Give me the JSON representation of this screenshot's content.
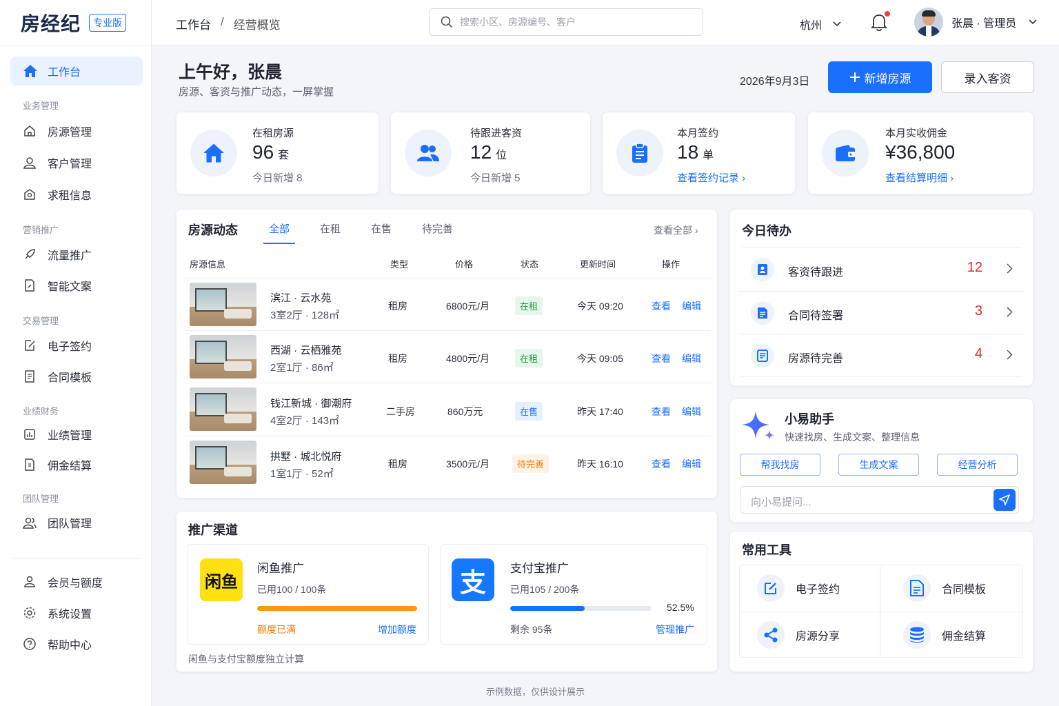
{
  "brand": {
    "name": "房经纪",
    "badge": "专业版"
  },
  "nav": {
    "active": "工作台",
    "groups": {
      "business": "业务管理",
      "marketing": "营销推广",
      "trade": "交易管理",
      "finance": "业绩财务",
      "team": "团队管理"
    },
    "items": {
      "property": "房源管理",
      "customer": "客户管理",
      "rent_info": "求租信息",
      "traffic": "流量推广",
      "copywriting": "智能文案",
      "esign": "电子签约",
      "contract_tpl": "合同模板",
      "performance": "业绩管理",
      "commission": "佣金结算",
      "team": "团队管理",
      "membership": "会员与额度",
      "settings": "系统设置",
      "help": "帮助中心"
    }
  },
  "topbar": {
    "breadcrumb": [
      "工作台",
      "/",
      "经营概览"
    ],
    "search_placeholder": "搜索小区、房源编号、客户",
    "city": "杭州",
    "user": "张晨 · 管理员"
  },
  "header": {
    "greeting": "上午好，张晨",
    "subtitle": "房源、客资与推广动态，一屏掌握",
    "date": "2026年9月3日",
    "btn_add": "新增房源",
    "btn_lead": "录入客资"
  },
  "stats": [
    {
      "label": "在租房源",
      "value": "96",
      "unit": "套",
      "sub": "今日新增 8"
    },
    {
      "label": "待跟进客资",
      "value": "12",
      "unit": "位",
      "sub": "今日新增 5"
    },
    {
      "label": "本月签约",
      "value": "18",
      "unit": "单",
      "sub": "查看签约记录"
    },
    {
      "label": "本月实收佣金",
      "value": "¥36,800",
      "unit": "",
      "sub": "查看结算明细"
    }
  ],
  "listings": {
    "title": "房源动态",
    "tabs": [
      "全部",
      "在租",
      "在售",
      "待完善"
    ],
    "view_all": "查看全部",
    "columns": [
      "房源信息",
      "类型",
      "价格",
      "状态",
      "更新时间",
      "操作"
    ],
    "rows": [
      {
        "name": "滨江 · 云水苑",
        "spec": "3室2厅 · 128㎡",
        "type": "租房",
        "price": "6800元/月",
        "status": "在租",
        "time": "今天 09:20"
      },
      {
        "name": "西湖 · 云栖雅苑",
        "spec": "2室1厅 · 86㎡",
        "type": "租房",
        "price": "4800元/月",
        "status": "在租",
        "time": "今天 09:05"
      },
      {
        "name": "钱江新城 · 御潮府",
        "spec": "4室2厅 · 143㎡",
        "type": "二手房",
        "price": "860万元",
        "status": "在售",
        "time": "昨天 17:40"
      },
      {
        "name": "拱墅 · 城北悦府",
        "spec": "1室1厅 · 52㎡",
        "type": "租房",
        "price": "3500元/月",
        "status": "待完善",
        "time": "昨天 16:10"
      }
    ],
    "op_view": "查看",
    "op_edit": "编辑"
  },
  "todo": {
    "title": "今日待办",
    "items": [
      {
        "label": "客资待跟进",
        "count": "12"
      },
      {
        "label": "合同待签署",
        "count": "3"
      },
      {
        "label": "房源待完善",
        "count": "4"
      }
    ]
  },
  "assistant": {
    "title": "小易助手",
    "subtitle": "快速找房、生成文案、整理信息",
    "buttons": [
      "帮我找房",
      "生成文案",
      "经营分析"
    ],
    "placeholder": "向小易提问..."
  },
  "promo": {
    "title": "推广渠道",
    "channels": [
      {
        "name": "闲鱼推广",
        "logo": "闲鱼",
        "usage": "已用100 / 100条",
        "progress": 1.0,
        "percent": "",
        "left_text": "额度已满",
        "action": "增加额度",
        "color": "#f59a12"
      },
      {
        "name": "支付宝推广",
        "logo": "支",
        "usage": "已用105 / 200条",
        "progress": 0.525,
        "percent": "52.5%",
        "left_text": "剩余 95条",
        "action": "管理推广",
        "color": "#1a6fff"
      }
    ],
    "note": "闲鱼与支付宝额度独立计算"
  },
  "tools": {
    "title": "常用工具",
    "items": [
      "电子签约",
      "合同模板",
      "房源分享",
      "佣金结算"
    ]
  },
  "footer": "示例数据，仅供设计展示",
  "colors": {
    "primary": "#1a6fff",
    "danger": "#e52525",
    "green": "#1e9a44",
    "orange": "#f07a12"
  }
}
